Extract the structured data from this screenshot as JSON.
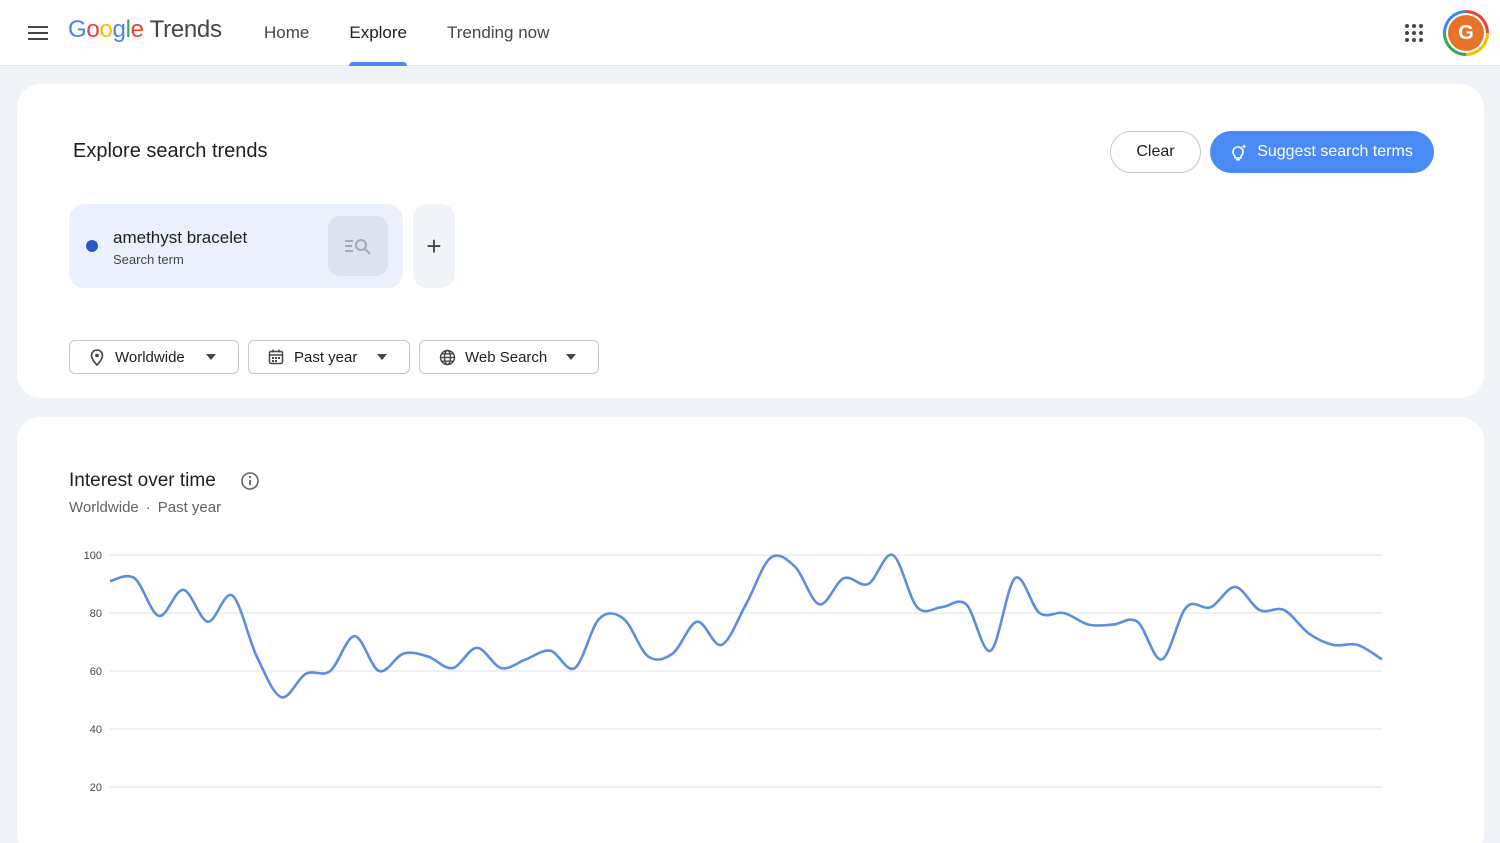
{
  "header": {
    "logo_google": [
      "G",
      "o",
      "o",
      "g",
      "l",
      "e"
    ],
    "logo_product": "Trends",
    "nav": [
      {
        "label": "Home",
        "active": false
      },
      {
        "label": "Explore",
        "active": true
      },
      {
        "label": "Trending now",
        "active": false
      }
    ],
    "avatar_initial": "G"
  },
  "explore": {
    "title": "Explore search trends",
    "clear_label": "Clear",
    "suggest_label": "Suggest search terms",
    "term": {
      "name": "amethyst bracelet",
      "type": "Search term",
      "color": "#2b56c9"
    },
    "add_symbol": "+",
    "filters": {
      "geo": "Worldwide",
      "time": "Past year",
      "property": "Web Search"
    }
  },
  "interest": {
    "title": "Interest over time",
    "subtitle_geo": "Worldwide",
    "subtitle_sep": "·",
    "subtitle_time": "Past year"
  },
  "colors": {
    "accent": "#4a8af4",
    "line": "#5b8ee0",
    "grid": "#e0e0e0"
  },
  "chart_data": {
    "type": "line",
    "y_ticks": [
      "100",
      "80",
      "60",
      "40",
      "20"
    ],
    "ylim": [
      0,
      100
    ],
    "grid": true,
    "series": [
      {
        "values": [
          91,
          92,
          79,
          88,
          77,
          86,
          65,
          51,
          59,
          60,
          72,
          60,
          66,
          65,
          61,
          68,
          61,
          64,
          67,
          61,
          78,
          78,
          65,
          66,
          77,
          69,
          83,
          99,
          96,
          83,
          92,
          90,
          100,
          82,
          82,
          83,
          67,
          92,
          80,
          80,
          76,
          76,
          77,
          64,
          82,
          82,
          89,
          81,
          81,
          73,
          69,
          69,
          64
        ]
      }
    ]
  }
}
